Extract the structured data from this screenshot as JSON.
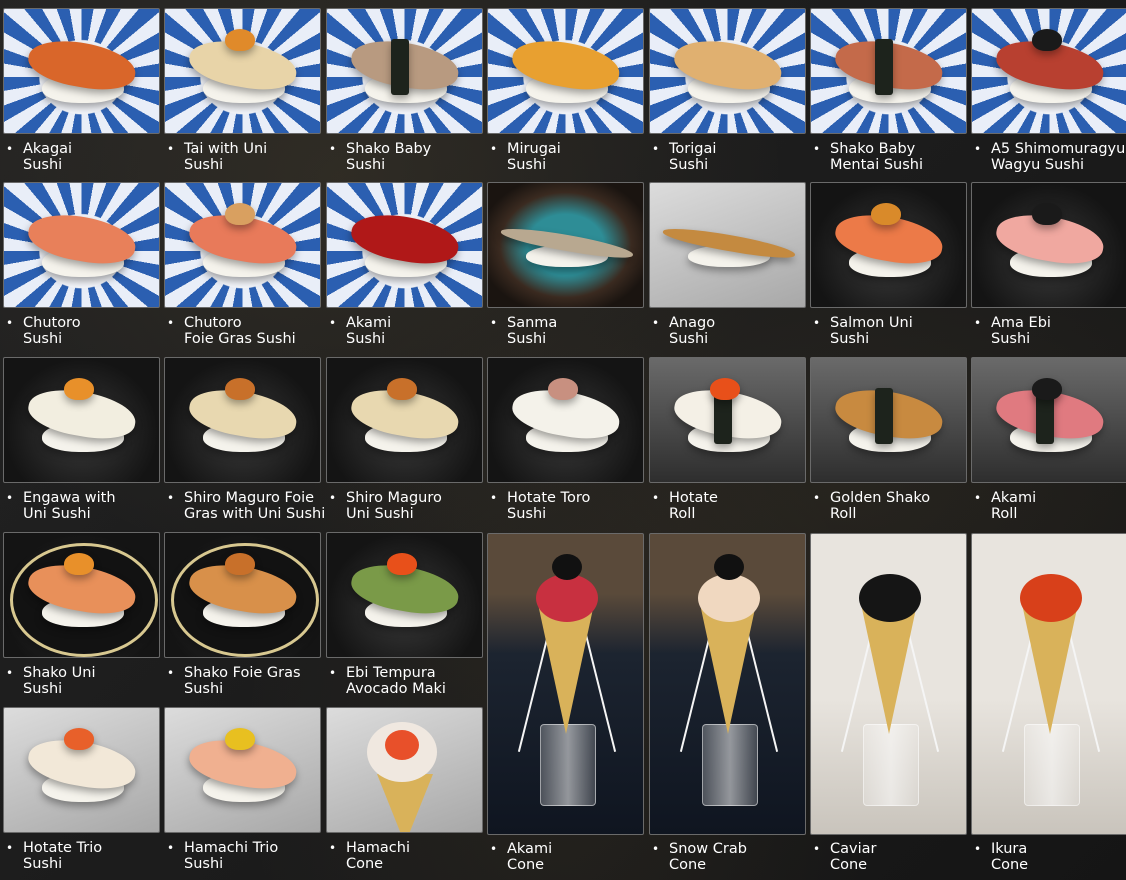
{
  "bullet": "•",
  "items": [
    {
      "line1": "Akagai",
      "line2": "Sushi"
    },
    {
      "line1": "Tai with Uni",
      "line2": "Sushi"
    },
    {
      "line1": "Shako Baby",
      "line2": "Sushi"
    },
    {
      "line1": "Mirugai",
      "line2": "Sushi"
    },
    {
      "line1": "Torigai",
      "line2": "Sushi"
    },
    {
      "line1": "Shako Baby",
      "line2": "Mentai Sushi"
    },
    {
      "line1": "A5 Shimomuragyu",
      "line2": "Wagyu Sushi"
    },
    {
      "line1": "Chutoro",
      "line2": "Sushi"
    },
    {
      "line1": "Chutoro",
      "line2": "Foie Gras Sushi"
    },
    {
      "line1": "Akami",
      "line2": "Sushi"
    },
    {
      "line1": "Sanma",
      "line2": "Sushi"
    },
    {
      "line1": "Anago",
      "line2": "Sushi"
    },
    {
      "line1": "Salmon Uni",
      "line2": "Sushi"
    },
    {
      "line1": "Ama Ebi",
      "line2": "Sushi"
    },
    {
      "line1": "Engawa with",
      "line2": "Uni Sushi"
    },
    {
      "line1": "Shiro Maguro Foie",
      "line2": "Gras with Uni Sushi"
    },
    {
      "line1": "Shiro Maguro",
      "line2": "Uni Sushi"
    },
    {
      "line1": "Hotate Toro",
      "line2": "Sushi"
    },
    {
      "line1": "Hotate",
      "line2": "Roll"
    },
    {
      "line1": "Golden Shako",
      "line2": "Roll"
    },
    {
      "line1": "Akami",
      "line2": "Roll"
    },
    {
      "line1": "Shako Uni",
      "line2": "Sushi"
    },
    {
      "line1": "Shako Foie Gras",
      "line2": "Sushi"
    },
    {
      "line1": "Ebi Tempura",
      "line2": "Avocado Maki"
    },
    {
      "line1": "Hotate Trio",
      "line2": "Sushi"
    },
    {
      "line1": "Hamachi Trio",
      "line2": "Sushi"
    },
    {
      "line1": "Hamachi",
      "line2": "Cone"
    },
    {
      "line1": "Akami",
      "line2": "Cone"
    },
    {
      "line1": "Snow Crab",
      "line2": "Cone"
    },
    {
      "line1": "Caviar",
      "line2": "Cone"
    },
    {
      "line1": "Ikura",
      "line2": "Cone"
    }
  ]
}
